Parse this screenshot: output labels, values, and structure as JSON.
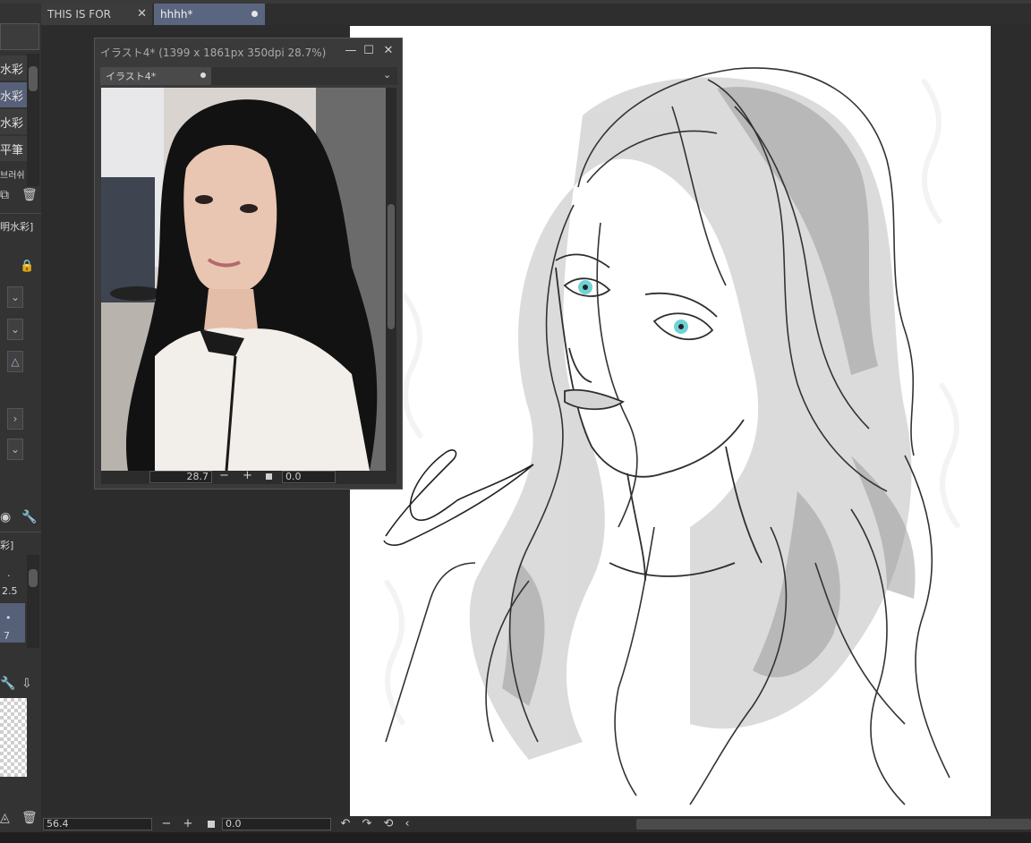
{
  "tabs": [
    {
      "label": "THIS IS FOR",
      "close": "✕"
    },
    {
      "label": "hhhh*"
    }
  ],
  "brush_list": {
    "items": [
      "水彩",
      "水彩",
      "水彩",
      "平筆"
    ],
    "selected_index": 1,
    "footer_label": "브러쉬"
  },
  "tool_property": {
    "name_label": "明水彩]",
    "sub_label": "彩]"
  },
  "brush_size": {
    "values": [
      ".",
      "2.5",
      "•",
      "7"
    ]
  },
  "sub_view": {
    "title": "イラスト4* (1399 x 1861px 350dpi 28.7%)",
    "tab_label": "イラスト4*",
    "zoom_value": "28.7",
    "rotation_value": "0.0"
  },
  "status_bar": {
    "zoom_value": "56.4",
    "rotation_value": "0.0"
  },
  "colors": {
    "accent_tab": "#5a6680",
    "selected_row": "#566078",
    "panel_bg": "#333333",
    "canvas_bg": "#ffffff"
  },
  "icons": [
    "close-icon",
    "minimize-icon",
    "maximize-icon",
    "lock-icon",
    "trash-icon",
    "new-layer-icon",
    "wrench-icon",
    "dial-icon",
    "import-icon",
    "undo-icon",
    "redo-icon",
    "reset-rotation-icon",
    "zoom-out-icon",
    "zoom-in-icon",
    "chevron-down-icon",
    "chevron-right-icon"
  ]
}
